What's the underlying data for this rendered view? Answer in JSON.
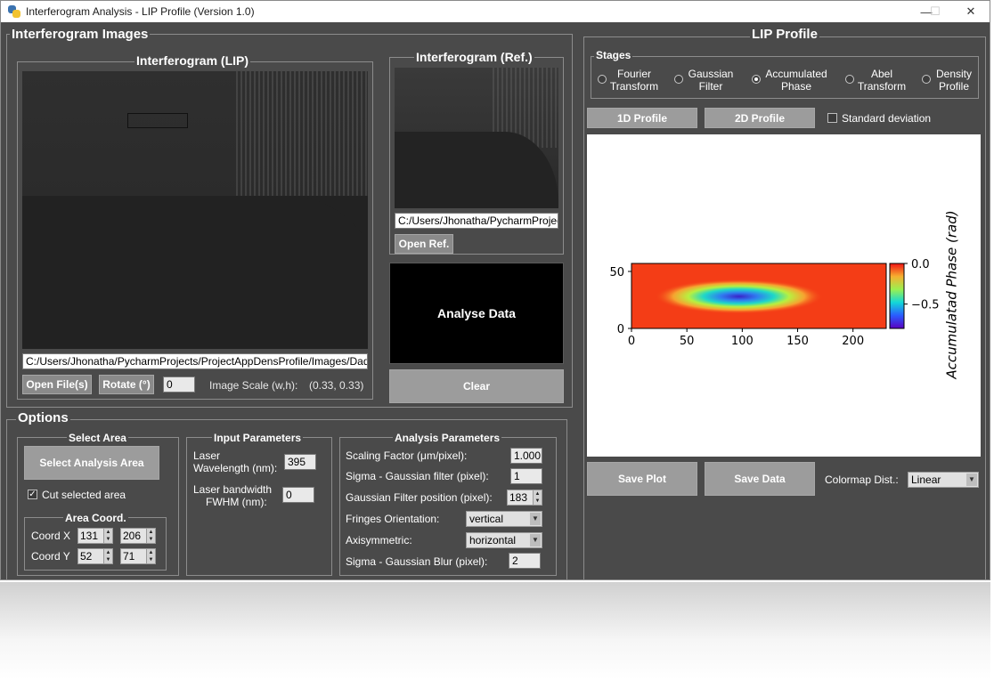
{
  "window": {
    "title": "Interferogram Analysis - LIP Profile (Version 1.0)",
    "minimize_symbol": "—",
    "maximize_symbol": "☐",
    "close_symbol": "✕"
  },
  "images_panel": {
    "title": "Interferogram Images",
    "lip": {
      "title": "Interferogram (LIP)",
      "path": "C:/Users/Jhonatha/PycharmProjects/ProjectAppDensProfile/Images/Dado",
      "open_label": "Open File(s)",
      "rotate_label": "Rotate (°)",
      "rotate_value": "0",
      "scale_label": "Image Scale (w,h):",
      "scale_value": "(0.33, 0.33)"
    },
    "ref": {
      "title": "Interferogram (Ref.)",
      "path": "C:/Users/Jhonatha/PycharmProjec",
      "open_label": "Open Ref."
    },
    "analyse_label": "Analyse Data",
    "clear_label": "Clear"
  },
  "options": {
    "title": "Options",
    "select_area": {
      "title": "Select Area",
      "button_label": "Select Analysis Area",
      "cut_label": "Cut selected area",
      "cut_checked": true,
      "coord_title": "Area Coord.",
      "coord_x_label": "Coord X",
      "coord_x1": "131",
      "coord_x2": "206",
      "coord_y_label": "Coord Y",
      "coord_y1": "52",
      "coord_y2": "71"
    },
    "input_params": {
      "title": "Input Parameters",
      "wavelength_label_1": "Laser",
      "wavelength_label_2": "Wavelength (nm):",
      "wavelength_value": "395",
      "bandwidth_label_1": "Laser bandwidth",
      "bandwidth_label_2": "FWHM  (nm):",
      "bandwidth_value": "0"
    },
    "analysis_params": {
      "title": "Analysis Parameters",
      "scaling_label": "Scaling Factor (μm/pixel):",
      "scaling_value": "1.000",
      "sigma_gauss_label": "Sigma - Gaussian filter (pixel):",
      "sigma_gauss_value": "1",
      "gauss_pos_label": "Gaussian Filter position (pixel):",
      "gauss_pos_value": "183",
      "fringes_label": "Fringes Orientation:",
      "fringes_value": "vertical",
      "axisym_label": "Axisymmetric:",
      "axisym_value": "horizontal",
      "sigma_blur_label": "Sigma - Gaussian Blur (pixel):",
      "sigma_blur_value": "2"
    }
  },
  "lip_profile": {
    "title": "LIP Profile",
    "stages_title": "Stages",
    "stages": [
      {
        "line1": "Fourier",
        "line2": "Transform",
        "selected": false
      },
      {
        "line1": "Gaussian",
        "line2": "Filter",
        "selected": false
      },
      {
        "line1": "Accumulated",
        "line2": "Phase",
        "selected": true
      },
      {
        "line1": "Abel",
        "line2": "Transform",
        "selected": false
      },
      {
        "line1": "Density",
        "line2": "Profile",
        "selected": false
      }
    ],
    "profile_1d_label": "1D Profile",
    "profile_2d_label": "2D Profile",
    "std_label": "Standard deviation",
    "std_checked": false,
    "save_plot_label": "Save Plot",
    "save_data_label": "Save Data",
    "colormap_label": "Colormap Dist.:",
    "colormap_value": "Linear"
  },
  "chart_data": {
    "type": "heatmap",
    "title": "",
    "xlabel": "",
    "ylabel": "",
    "colorbar_label": "Accumulatad Phase  (rad)",
    "xlim": [
      0,
      230
    ],
    "ylim": [
      0,
      57
    ],
    "xticks": [
      0,
      50,
      100,
      150,
      200
    ],
    "yticks": [
      0,
      50
    ],
    "colorbar_range": [
      -0.8,
      0.0
    ],
    "colorbar_ticks": [
      "0.0",
      "−0.5"
    ],
    "colormap": "rainbow",
    "feature": {
      "description_value_min": -0.8,
      "center_x": 97,
      "center_y": 28,
      "sigma_x": 40,
      "sigma_y": 8
    },
    "grid": false
  }
}
